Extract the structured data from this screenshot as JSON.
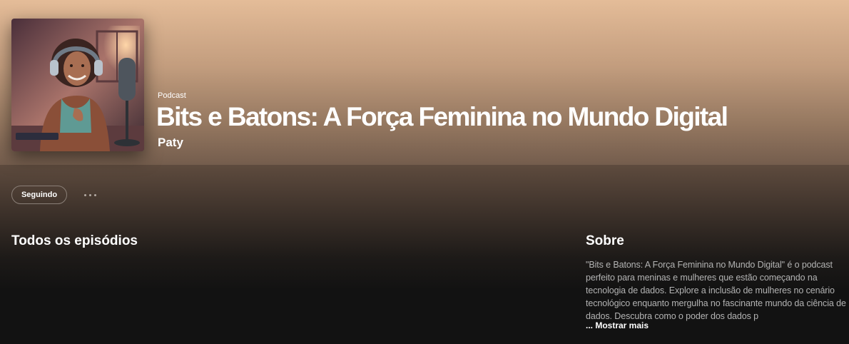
{
  "header": {
    "kind_label": "Podcast",
    "title": "Bits e Batons: A Força Feminina no Mundo Digital",
    "author": "Paty"
  },
  "actions": {
    "follow_label": "Seguindo",
    "more_icon": "ellipsis-icon"
  },
  "episodes": {
    "title": "Todos os episódios"
  },
  "about": {
    "title": "Sobre",
    "description": "\"Bits e Batons: A Força Feminina no Mundo Digital\" é o podcast perfeito para meninas e mulheres que estão começando na tecnologia de dados. Explore a inclusão de mulheres no cenário tecnológico enquanto mergulha no fascinante mundo da ciência de dados. Descubra como o poder dos dados p",
    "show_more": "... Mostrar mais"
  },
  "colors": {
    "hero_top": "#e4bc98",
    "hero_bottom": "#7e6553",
    "background": "#121212",
    "muted_text": "#b3b3b3"
  }
}
